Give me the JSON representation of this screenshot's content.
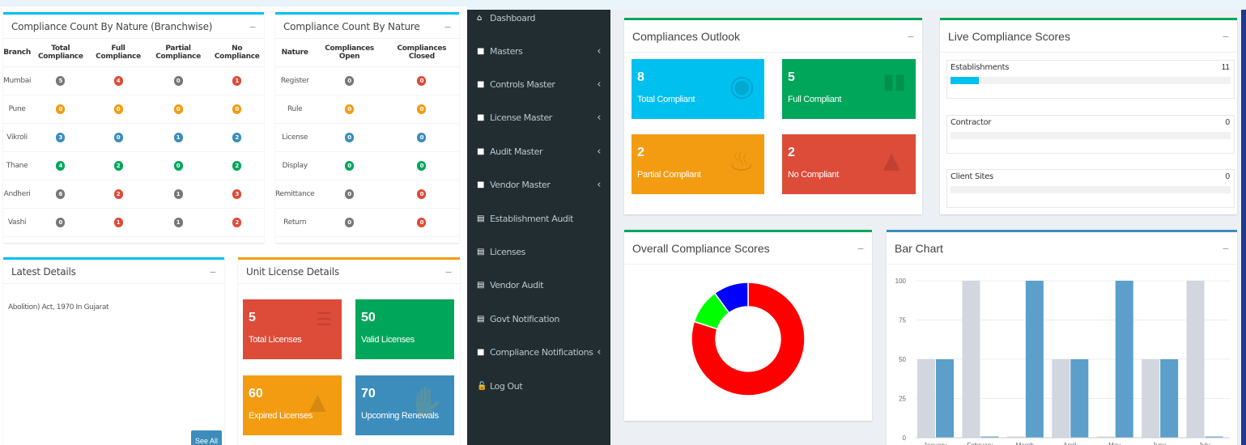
{
  "branchwise": {
    "title": "Compliance Count By Nature (Branchwise)",
    "columns": [
      "Branch",
      "Total Compliance",
      "Full Compliance",
      "Partial Compliance",
      "No Compliance"
    ],
    "rows": [
      {
        "label": "Mumbai",
        "badges": [
          [
            "5",
            "#777777"
          ],
          [
            "4",
            "#dd4b39"
          ],
          [
            "0",
            "#777777"
          ],
          [
            "1",
            "#dd4b39"
          ]
        ]
      },
      {
        "label": "Pune",
        "badges": [
          [
            "0",
            "#f39c12"
          ],
          [
            "0",
            "#f39c12"
          ],
          [
            "0",
            "#f39c12"
          ],
          [
            "0",
            "#f39c12"
          ]
        ]
      },
      {
        "label": "Vikroli",
        "badges": [
          [
            "3",
            "#3c8dbc"
          ],
          [
            "0",
            "#3c8dbc"
          ],
          [
            "1",
            "#3c8dbc"
          ],
          [
            "2",
            "#3c8dbc"
          ]
        ]
      },
      {
        "label": "Thane",
        "badges": [
          [
            "4",
            "#00a65a"
          ],
          [
            "2",
            "#00a65a"
          ],
          [
            "0",
            "#00a65a"
          ],
          [
            "2",
            "#00a65a"
          ]
        ]
      },
      {
        "label": "Andheri",
        "badges": [
          [
            "6",
            "#777777"
          ],
          [
            "2",
            "#dd4b39"
          ],
          [
            "1",
            "#777777"
          ],
          [
            "3",
            "#dd4b39"
          ]
        ]
      },
      {
        "label": "Vashi",
        "badges": [
          [
            "0",
            "#777777"
          ],
          [
            "1",
            "#dd4b39"
          ],
          [
            "1",
            "#777777"
          ],
          [
            "2",
            "#dd4b39"
          ]
        ]
      }
    ]
  },
  "nature": {
    "title": "Compliance Count By Nature",
    "columns": [
      "Nature",
      "Compliances Open",
      "Compliances Closed"
    ],
    "rows": [
      {
        "label": "Register",
        "badges": [
          [
            "0",
            "#777777"
          ],
          [
            "0",
            "#dd4b39"
          ]
        ]
      },
      {
        "label": "Rule",
        "badges": [
          [
            "0",
            "#f39c12"
          ],
          [
            "0",
            "#f39c12"
          ]
        ]
      },
      {
        "label": "License",
        "badges": [
          [
            "0",
            "#3c8dbc"
          ],
          [
            "0",
            "#3c8dbc"
          ]
        ]
      },
      {
        "label": "Display",
        "badges": [
          [
            "0",
            "#00a65a"
          ],
          [
            "0",
            "#00a65a"
          ]
        ]
      },
      {
        "label": "Remittance",
        "badges": [
          [
            "0",
            "#777777"
          ],
          [
            "0",
            "#dd4b39"
          ]
        ]
      },
      {
        "label": "Return",
        "badges": [
          [
            "0",
            "#777777"
          ],
          [
            "0",
            "#dd4b39"
          ]
        ]
      }
    ]
  },
  "latest": {
    "title": "Latest Details",
    "text": "Abolition) Act, 1970 In Gujarat",
    "see_all": "See All"
  },
  "license": {
    "title": "Unit License Details",
    "tiles": [
      {
        "value": "5",
        "label": "Total Licenses",
        "color": "#dd4b39"
      },
      {
        "value": "50",
        "label": "Valid Licenses",
        "color": "#00a65a"
      },
      {
        "value": "60",
        "label": "Expired Licenses",
        "color": "#f39c12"
      },
      {
        "value": "70",
        "label": "Upcoming Renewals",
        "color": "#3c8dbc"
      }
    ]
  },
  "sidebar": {
    "items": [
      {
        "label": "Dashboard",
        "chevron": false
      },
      {
        "label": "Masters",
        "chevron": true
      },
      {
        "label": "Controls Master",
        "chevron": true
      },
      {
        "label": "License Master",
        "chevron": true
      },
      {
        "label": "Audit Master",
        "chevron": true
      },
      {
        "label": "Vendor Master",
        "chevron": true
      },
      {
        "label": "Establishment Audit",
        "chevron": false
      },
      {
        "label": "Licenses",
        "chevron": false
      },
      {
        "label": "Vendor Audit",
        "chevron": false
      },
      {
        "label": "Govt Notification",
        "chevron": false
      },
      {
        "label": "Compliance Notifications",
        "chevron": true
      },
      {
        "label": "Log Out",
        "chevron": false
      }
    ]
  },
  "outlook": {
    "title": "Compliances Outlook",
    "tiles": [
      {
        "value": "8",
        "label": "Total Compliant",
        "color": "#00c0ef"
      },
      {
        "value": "5",
        "label": "Full Compliant",
        "color": "#00a65a"
      },
      {
        "value": "2",
        "label": "Partial Compliant",
        "color": "#f39c12"
      },
      {
        "value": "2",
        "label": "No Compliant",
        "color": "#dd4b39"
      }
    ]
  },
  "live_scores": {
    "title": "Live Compliance Scores",
    "rows": [
      {
        "name": "Establishments",
        "value": "11",
        "fill": 0.1
      },
      {
        "name": "Contractor",
        "value": "0",
        "fill": 0
      },
      {
        "name": "Client Sites",
        "value": "0",
        "fill": 0
      }
    ]
  },
  "overall": {
    "title": "Overall Compliance Scores"
  },
  "bar_chart_panel": {
    "title": "Bar Chart"
  },
  "chart_data": [
    {
      "type": "pie",
      "title": "",
      "values": [
        80,
        10,
        10
      ],
      "colors": [
        "#ff0000",
        "#00ff00",
        "#0000ff"
      ]
    },
    {
      "type": "bar",
      "title": "",
      "categories": [
        "January",
        "February",
        "March",
        "April",
        "May",
        "June",
        "July"
      ],
      "series": [
        {
          "values": [
            50,
            100,
            0,
            50,
            0,
            50,
            100
          ],
          "color": "#d2d6de"
        },
        {
          "values": [
            50,
            0,
            100,
            50,
            100,
            50,
            0
          ],
          "color": "#5b9fca"
        }
      ],
      "ylim": [
        0,
        100
      ],
      "yticks": [
        "0",
        "25",
        "50",
        "75",
        "100"
      ]
    }
  ]
}
